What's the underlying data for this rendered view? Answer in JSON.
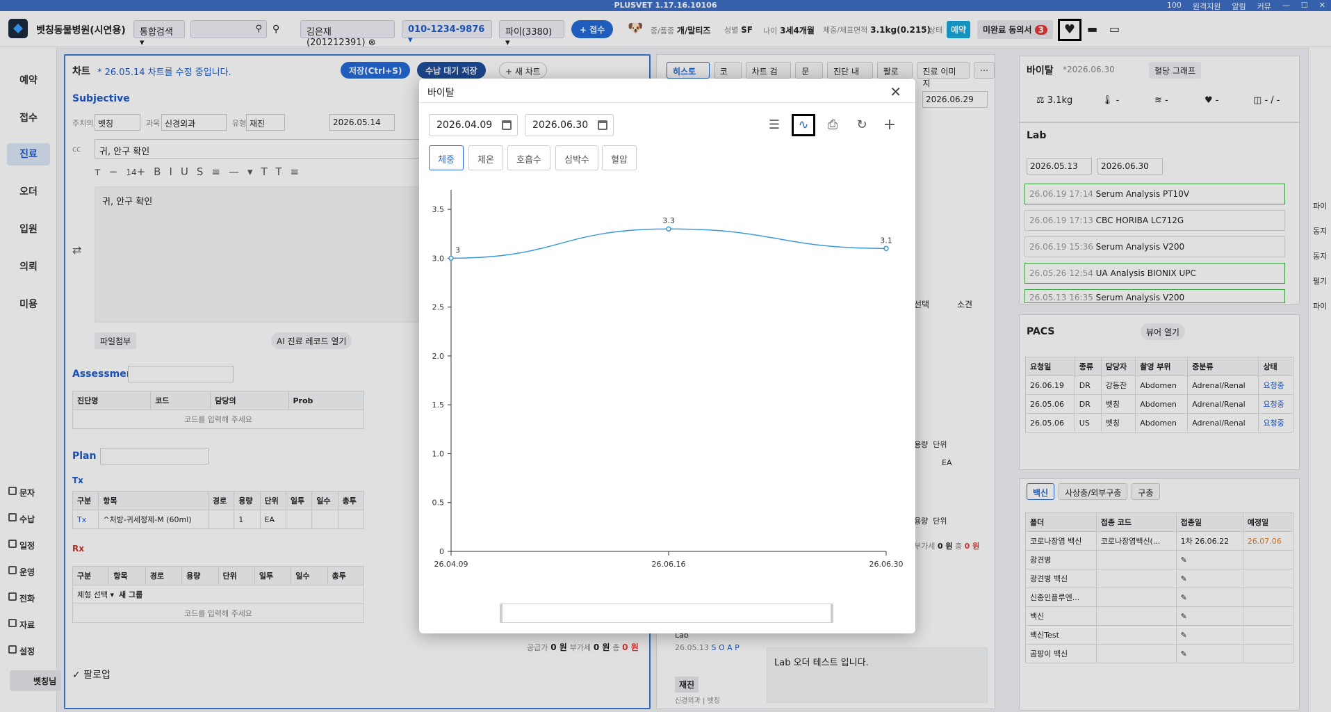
{
  "titlebar": {
    "title": "PLUSVET 1.17.16.10106",
    "zoom": "100",
    "remote": "원격지원",
    "call": "통화",
    "notify": "알림",
    "shutdown": "커뮤"
  },
  "header": {
    "hospital": "벳칭동물병원(시연용)",
    "search_mode": "통합검색",
    "owner": "김은재(201212391)",
    "phone": "010-1234-9876",
    "pet": "파이(3380)",
    "reception_btn": "+ 접수",
    "species_label": "종/품종",
    "species": "개/말티즈",
    "sex_label": "성별",
    "sex": "SF",
    "age_label": "나이",
    "age": "3세4개월",
    "weight_label": "체중/체표면적",
    "weight": "3.1kg(0.215)",
    "status_label": "상태",
    "status": "예약",
    "consent_label": "미완료 동의서",
    "consent_count": "3"
  },
  "left_nav": {
    "items": [
      "예약",
      "접수",
      "진료",
      "오더",
      "입원",
      "의뢰",
      "미용"
    ],
    "selected": 2,
    "bottom": [
      "문자",
      "수납",
      "일정",
      "운영",
      "전화",
      "자료",
      "설정"
    ],
    "user": "벳칭님"
  },
  "chart": {
    "title": "차트",
    "notice": "* 26.05.14 차트를 수정 중입니다.",
    "save_btn": "저장(Ctrl+S)",
    "wait_btn": "수납 대기 저장",
    "new_btn": "+ 새 차트",
    "subjective": "Subjective",
    "vet_label": "주치의",
    "vet": "벳칭",
    "dept_label": "과목",
    "dept": "신경외과",
    "type_label": "유형",
    "type": "재진",
    "date": "2026.05.14",
    "cc_label": "cc",
    "cc": "귀, 안구 확인",
    "font_size": "14",
    "body": "귀, 안구 확인",
    "attach_btn": "파일첨부",
    "ai_btn": "AI 진료 레코드 열기",
    "assessment": "Assessment",
    "diag_headers": [
      "진단명",
      "코드",
      "담당의",
      "Prob"
    ],
    "code_hint": "코드를 입력해 주세요",
    "plan": "Plan",
    "tx_label": "Tx",
    "rx_label": "Rx",
    "plan_headers": [
      "구분",
      "항목",
      "경로",
      "용량",
      "단위",
      "일투",
      "일수",
      "총투",
      "총량",
      "실"
    ],
    "tx_row": [
      "Tx",
      "^처방-귀세정제-M (60ml)",
      "",
      "1",
      "EA"
    ],
    "rx_group": "제형 선택",
    "rx_new_group": "새 그룹",
    "supply_label": "공급가",
    "supply": "0 원",
    "vat_label": "부가세",
    "vat": "0 원",
    "total_label": "총",
    "total": "0 원",
    "followup": "팔로업"
  },
  "history": {
    "tabs": [
      "히스토리",
      "코드",
      "차트 검색",
      "문진",
      "진단 내역",
      "팔로업",
      "진료 이미지"
    ],
    "date": "2026.06.29",
    "select_btn": "선택",
    "cancel_btn": "소견",
    "col_dose": "용량",
    "col_unit": "단위",
    "col_ea": "EA",
    "vat": "부가세",
    "vat_val": "0 원",
    "total": "총",
    "total_val": "0 원",
    "lab_label": "Lab",
    "lab_date": "26.05.13",
    "soap": "S O A P",
    "revisit": "재진",
    "dept_vet": "신경외과 | 벳칭",
    "lab_note": "Lab 오더 테스트 입니다."
  },
  "vitals_panel": {
    "title": "바이탈",
    "date": "*2026.06.30",
    "graph_btn": "혈당 그래프",
    "weight": "3.1kg",
    "temp": "-",
    "resp": "-",
    "heart": "-",
    "bp": "- / -"
  },
  "lab_panel": {
    "title": "Lab",
    "from": "2026.05.13",
    "to": "2026.06.30",
    "rows": [
      {
        "time": "26.06.19 17:14",
        "name": "Serum Analysis",
        "device": "PT10V",
        "hl": true
      },
      {
        "time": "26.06.19 17:13",
        "name": "CBC",
        "device": "HORIBA LC712G",
        "hl": false
      },
      {
        "time": "26.06.19 15:36",
        "name": "Serum Analysis",
        "device": "V200",
        "hl": false
      },
      {
        "time": "26.05.26 12:54",
        "name": "UA Analysis",
        "device": "BIONIX UPC",
        "hl": true
      },
      {
        "time": "26.05.13 16:35",
        "name": "Serum Analysis",
        "device": "V200",
        "hl": true
      }
    ]
  },
  "pacs_panel": {
    "title": "PACS",
    "viewer_btn": "뷰어 열기",
    "headers": [
      "요청일",
      "종류",
      "담당자",
      "촬영 부위",
      "중분류",
      "상태"
    ],
    "rows": [
      [
        "26.06.19",
        "DR",
        "강동찬",
        "Abdomen",
        "Adrenal/Renal",
        "요청중"
      ],
      [
        "26.05.06",
        "DR",
        "벳칭",
        "Abdomen",
        "Adrenal/Renal",
        "요청중"
      ],
      [
        "26.05.06",
        "US",
        "벳칭",
        "Abdomen",
        "Adrenal/Renal",
        "요청중"
      ]
    ]
  },
  "vaccine_panel": {
    "tabs": [
      "백신",
      "사상충/외부구충",
      "구충"
    ],
    "headers": [
      "폴더",
      "접종 코드",
      "접종일",
      "예정일"
    ],
    "rows": [
      [
        "코로나장염 백신",
        "코로나장염백신(...",
        "1차  26.06.22",
        "26.07.06"
      ],
      [
        "광견병",
        "",
        "",
        ""
      ],
      [
        "광견병 백신",
        "",
        "",
        ""
      ],
      [
        "신종인플루엔...",
        "",
        "",
        ""
      ],
      [
        "백신",
        "",
        "",
        ""
      ],
      [
        "백신Test",
        "",
        "",
        ""
      ],
      [
        "곰팡이 백신",
        "",
        "",
        ""
      ]
    ]
  },
  "right_nav": [
    "파이",
    "동지",
    "동지",
    "펄기",
    "파이"
  ],
  "modal": {
    "title": "바이탈",
    "from": "2026.04.09",
    "to": "2026.06.30",
    "tabs": [
      "체중",
      "체온",
      "호흡수",
      "심박수",
      "혈압"
    ],
    "selected_tab": 0
  },
  "chart_data": {
    "type": "line",
    "x": [
      "26.04.09",
      "26.06.16",
      "26.06.30"
    ],
    "series": [
      {
        "values": [
          3,
          3.3,
          3.1
        ],
        "color": "#3a9ad9"
      }
    ],
    "yticks": [
      "0",
      "0.5",
      "1.0",
      "1.5",
      "2.0",
      "2.5",
      "3.0",
      "3.5"
    ],
    "ylim": [
      0,
      3.7
    ],
    "grid": false
  }
}
